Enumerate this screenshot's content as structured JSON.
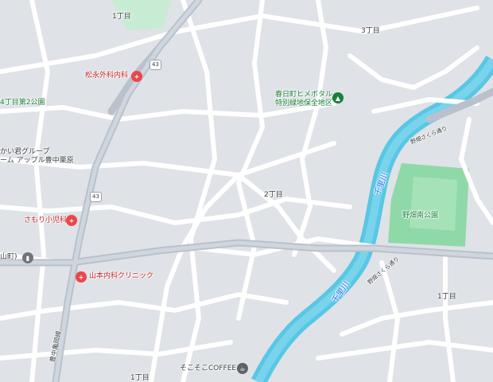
{
  "map": {
    "colors": {
      "background": "#ebedf0",
      "block": "#dfe2e6",
      "road": "#ffffff",
      "major_road": "#b9c1cc",
      "river": "#58c7e4",
      "park": "#8fd9a8",
      "school": "#c8ebd3",
      "medical": "#e8474b",
      "poi_green": "#188038"
    },
    "labels": {
      "chome_1_top": "1丁目",
      "chome_3": "3丁目",
      "chome_2": "2丁目",
      "chome_1_right": "1丁目",
      "chome_1_bottom": "1丁目",
      "park_4chome": "4丁目第2公園",
      "group_home_1": "かい君グループ",
      "group_home_2": "ーム アップル豊中栗原",
      "kasuga_1": "春日町ヒメボタル",
      "kasuga_2": "特別緑地保全地区",
      "nose_park": "野畑南公園",
      "chisato_river_1": "千里川",
      "chisato_river_2": "千里川",
      "sakura_1": "野畑さくら通り",
      "sakura_2": "野畑さくら通り",
      "toyonaka_road": "豊中亀岡線",
      "yama_town": "山町)",
      "route_43_top": "43",
      "route_43_mid": "43"
    },
    "pois": {
      "matsunaga": {
        "name": "松永外科内科",
        "icon": "hospital-icon"
      },
      "samori": {
        "name": "さもり小児科",
        "icon": "hospital-icon"
      },
      "yamamoto": {
        "name": "山本内科クリニック",
        "icon": "hospital-icon"
      },
      "cafe": {
        "name": "そこそこCOFFEE",
        "icon": "cafe-icon"
      },
      "kasuga_pin": {
        "icon": "tree-icon"
      },
      "yama_pin": {
        "icon": "building-icon"
      }
    }
  }
}
